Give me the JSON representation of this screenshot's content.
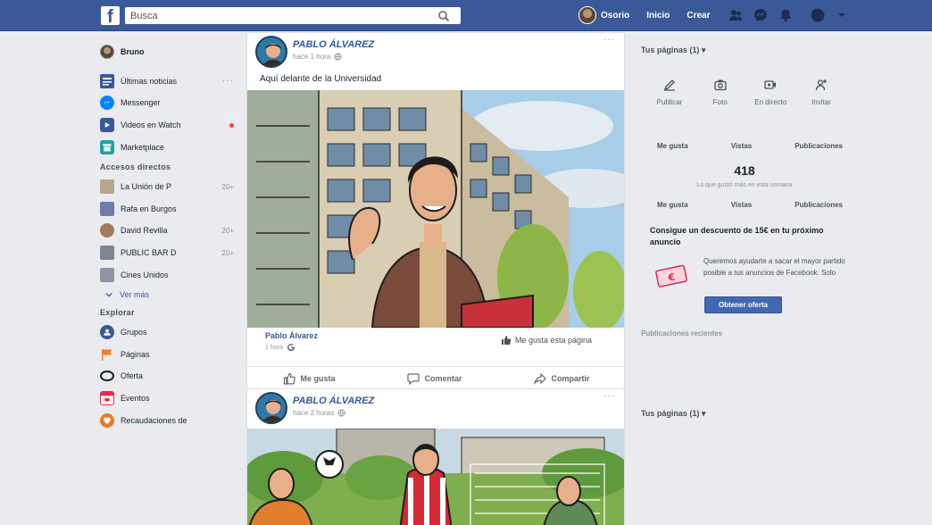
{
  "topbar": {
    "logo": "f",
    "search_placeholder": "Busca",
    "profile_name": "Osorio",
    "links": [
      "Inicio",
      "Crear"
    ],
    "icons": [
      "friends-icon",
      "messenger-icon",
      "bell-icon",
      "help-icon"
    ]
  },
  "leftnav": {
    "profile": "Bruno",
    "items": [
      {
        "label": "Últimas noticias",
        "dots": "···",
        "icon": "news-icon",
        "color": "#3b5998"
      },
      {
        "label": "Messenger",
        "icon": "messenger-icon",
        "color": "#0084ff"
      },
      {
        "label": "Videos en Watch",
        "icon": "watch-icon",
        "color": "#3b5998"
      },
      {
        "label": "Marketplace",
        "icon": "marketplace-icon",
        "color": "#20a39e"
      }
    ],
    "shortcuts_title": "Accesos directos",
    "shortcuts": [
      {
        "label": "La Unión de P",
        "count": "20+",
        "icon": "page-icon",
        "color": "#b7a58c"
      },
      {
        "label": "Rafa en Burgos",
        "icon": "page-icon",
        "color": "#6f7ca8"
      },
      {
        "label": "David Revilla",
        "count": "20+",
        "icon": "page-icon",
        "color": "#a07c5b"
      },
      {
        "label": "PUBLIC BAR D",
        "count": "20+",
        "icon": "page-icon",
        "color": "#7d8591"
      },
      {
        "label": "Cines Unidos",
        "icon": "page-icon",
        "color": "#8e96a3"
      }
    ],
    "more_label": "Ver más",
    "explore_title": "Explorar",
    "explore": [
      {
        "label": "Grupos",
        "icon": "groups-icon",
        "color": "#3b5998"
      },
      {
        "label": "Páginas",
        "icon": "flag-icon",
        "color": "#f57d28"
      },
      {
        "label": "Oferta",
        "icon": "offer-icon",
        "color": "#1d2129"
      },
      {
        "label": "Eventos",
        "icon": "calendar-icon",
        "color": "#f02849"
      },
      {
        "label": "Recaudaciones de",
        "icon": "fundraiser-icon",
        "color": "#e57b2a"
      }
    ]
  },
  "posts": [
    {
      "author": "PABLO ÁLVAREZ",
      "meta": "hace 1 hora",
      "more": "···",
      "text": "Aquí delante de la Universidad",
      "page_name": "Pablo Álvarez",
      "page_sub": "1 hora",
      "like_page": "Me gusta esta página",
      "actions": [
        "Me gusta",
        "Comentar",
        "Compartir"
      ]
    },
    {
      "author": "PABLO ÁLVAREZ",
      "meta": "hace 2 horas",
      "more": "···"
    }
  ],
  "right": {
    "pages_title": "Tus páginas (1) ▾",
    "actions": [
      {
        "label": "Publicar",
        "icon": "edit-icon"
      },
      {
        "label": "Foto",
        "icon": "camera-icon"
      },
      {
        "label": "En directo",
        "icon": "live-icon"
      },
      {
        "label": "Invitar",
        "icon": "invite-icon"
      }
    ],
    "stats_labels": [
      "Me gusta",
      "Vistas",
      "Publicaciones"
    ],
    "likes_number": "418",
    "caption": "Lo que gustó más en esta semana",
    "stats_labels_2": [
      "Me gusta",
      "Vistas",
      "Publicaciones"
    ],
    "promo_title": "Consigue un descuento de 15€ en tu próximo anuncio",
    "promo_text": "Queremos ayudarte a sacar el mayor partido posible a tus anuncios de Facebook. Solo",
    "promo_button": "Obtener oferta",
    "recent_label": "Publicaciones recientes",
    "pages_title_2": "Tus páginas (1) ▾"
  }
}
